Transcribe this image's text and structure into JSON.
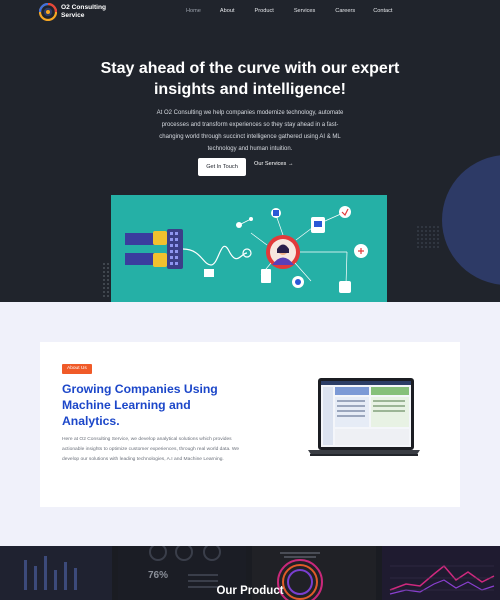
{
  "brand": {
    "name": "O2 Consulting Service"
  },
  "nav": {
    "items": [
      "Home",
      "About",
      "Product",
      "Services",
      "Careers",
      "Contact"
    ],
    "active": "Home"
  },
  "hero": {
    "title": "Stay ahead of the curve with our expert insights and intelligence!",
    "description": "At O2 Consulting we help companies modernize technology, automate processes and transform experiences so they stay ahead in a fast-changing world through succinct intelligence gathered using AI & ML technology and human intuition.",
    "primary_button": "Get In Touch",
    "secondary_link": "Our Services →"
  },
  "about": {
    "badge": "About Us",
    "title": "Growing Companies Using Machine Learning and Analytics.",
    "text": "Here at O2 Consulting Service, we develop analytical solutions which provides actionable insights to optimize customer experiences, through real world data. We develop our solutions with leading technologies, A.I and Machine Learning."
  },
  "products": {
    "stat": "76%",
    "title": "Our Product"
  },
  "colors": {
    "hero_bg": "#20242c",
    "teal": "#25b0a6",
    "accent_orange": "#f05a28",
    "heading_blue": "#1c47c9",
    "section_bg": "#f0f1fa"
  }
}
